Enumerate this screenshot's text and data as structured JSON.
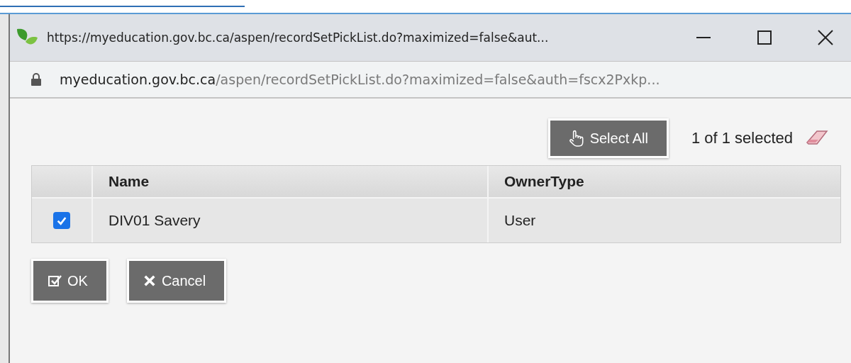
{
  "window": {
    "title": "https://myeducation.gov.bc.ca/aspen/recordSetPickList.do?maximized=false&aut..."
  },
  "address_bar": {
    "host": "myeducation.gov.bc.ca",
    "path": "/aspen/recordSetPickList.do?maximized=false&auth=fscx2Pxkp..."
  },
  "toolbar": {
    "select_all": "Select All",
    "selection_count": "1 of 1 selected"
  },
  "table": {
    "columns": [
      "Name",
      "OwnerType"
    ],
    "rows": [
      {
        "selected": true,
        "cells": [
          "DIV01 Savery",
          "User"
        ]
      }
    ]
  },
  "buttons": [
    {
      "kind": "ok",
      "label": "OK"
    },
    {
      "kind": "cancel",
      "label": "Cancel"
    }
  ]
}
